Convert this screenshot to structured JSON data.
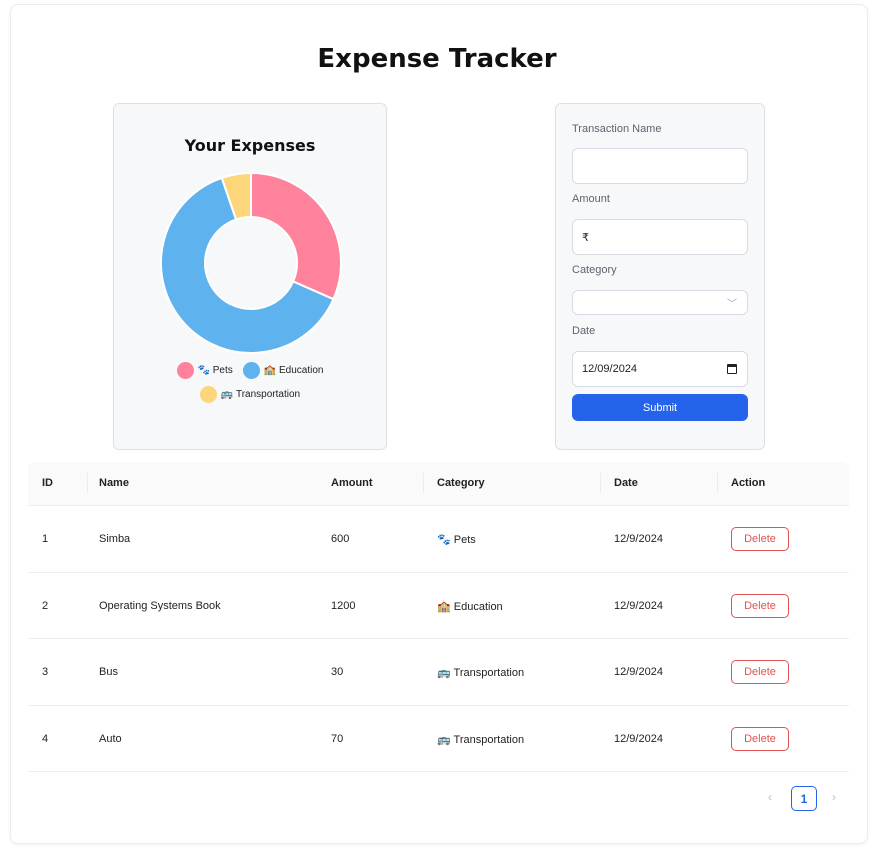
{
  "app": {
    "title": "Expense Tracker"
  },
  "chart_data": {
    "type": "pie",
    "title": "Your Expenses",
    "categories": [
      "🐾 Pets",
      "🏫 Education",
      "🚌 Transportation"
    ],
    "values": [
      600,
      1200,
      100
    ],
    "colors": [
      "#ff829d",
      "#5eb2ee",
      "#fdd67c"
    ],
    "legend_placement": "bottom"
  },
  "form": {
    "transaction_name_label": "Transaction Name",
    "transaction_name_value": "",
    "amount_label": "Amount",
    "amount_prefix": "₹",
    "category_label": "Category",
    "category_value": "",
    "date_label": "Date",
    "date_value": "12/09/2024",
    "submit_label": "Submit"
  },
  "table": {
    "columns": [
      "ID",
      "Name",
      "Amount",
      "Category",
      "Date",
      "Action"
    ],
    "rows": [
      {
        "id": "1",
        "name": "Simba",
        "amount": "600",
        "category": "🐾 Pets",
        "date": "12/9/2024",
        "action": "Delete"
      },
      {
        "id": "2",
        "name": "Operating Systems Book",
        "amount": "1200",
        "category": "🏫 Education",
        "date": "12/9/2024",
        "action": "Delete"
      },
      {
        "id": "3",
        "name": "Bus",
        "amount": "30",
        "category": "🚌 Transportation",
        "date": "12/9/2024",
        "action": "Delete"
      },
      {
        "id": "4",
        "name": "Auto",
        "amount": "70",
        "category": "🚌 Transportation",
        "date": "12/9/2024",
        "action": "Delete"
      }
    ]
  },
  "pagination": {
    "prev": "‹",
    "current_page": "1",
    "next": "›"
  }
}
